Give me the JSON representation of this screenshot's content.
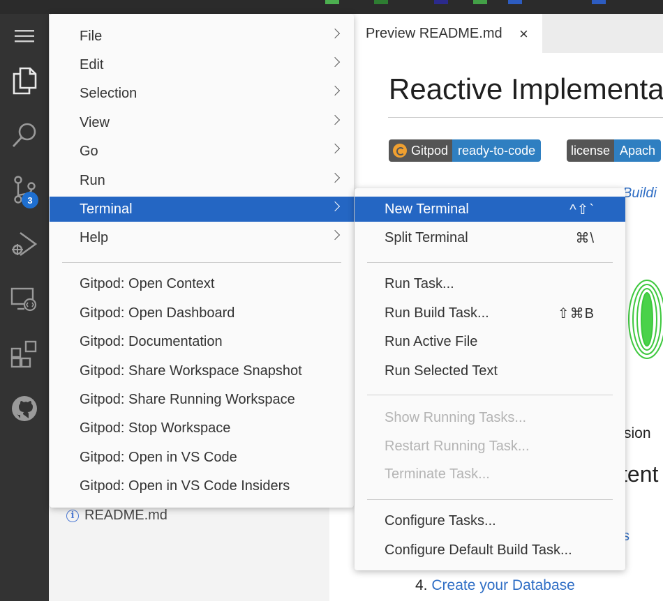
{
  "editor": {
    "tab_label": "Preview README.md",
    "tab_close": "×",
    "heading": "Reactive Implementa",
    "badge_gitpod_left": "Gitpod",
    "badge_gitpod_right": "ready-to-code",
    "badge_license_left": "license",
    "badge_license_right": "Apach",
    "link_fragment": "Buildi",
    "text_fragment_version": "rsion",
    "heading_fragment": "tent",
    "link_fragment_s": "s",
    "list_item_number": "4.",
    "list_item_link": "Create your Database"
  },
  "sidebar": {
    "file_name": "README.md",
    "info_glyph": "i"
  },
  "activity_bar": {
    "source_control_badge": "3",
    "icons": [
      "menu-icon",
      "files-icon",
      "search-icon",
      "source-control-icon",
      "run-debug-icon",
      "remote-explorer-icon",
      "extensions-icon",
      "github-icon"
    ]
  },
  "main_menu": {
    "items": [
      {
        "label": "File"
      },
      {
        "label": "Edit"
      },
      {
        "label": "Selection"
      },
      {
        "label": "View"
      },
      {
        "label": "Go"
      },
      {
        "label": "Run"
      },
      {
        "label": "Terminal"
      },
      {
        "label": "Help"
      }
    ],
    "gitpod_items": [
      {
        "label": "Gitpod: Open Context"
      },
      {
        "label": "Gitpod: Open Dashboard"
      },
      {
        "label": "Gitpod: Documentation"
      },
      {
        "label": "Gitpod: Share Workspace Snapshot"
      },
      {
        "label": "Gitpod: Share Running Workspace"
      },
      {
        "label": "Gitpod: Stop Workspace"
      },
      {
        "label": "Gitpod: Open in VS Code"
      },
      {
        "label": "Gitpod: Open in VS Code Insiders"
      }
    ]
  },
  "terminal_menu": {
    "items": [
      {
        "label": "New Terminal",
        "shortcut": "^⇧`"
      },
      {
        "label": "Split Terminal",
        "shortcut": "⌘\\"
      },
      {
        "label": "Run Task..."
      },
      {
        "label": "Run Build Task...",
        "shortcut": "⇧⌘B"
      },
      {
        "label": "Run Active File"
      },
      {
        "label": "Run Selected Text"
      },
      {
        "label": "Show Running Tasks..."
      },
      {
        "label": "Restart Running Task..."
      },
      {
        "label": "Terminate Task..."
      },
      {
        "label": "Configure Tasks..."
      },
      {
        "label": "Configure Default Build Task..."
      }
    ]
  },
  "colors": {
    "activity_bar": "#333333",
    "menu_highlight": "#2466c3",
    "badge": "#1e6fd0",
    "link": "#2f6ec5"
  }
}
